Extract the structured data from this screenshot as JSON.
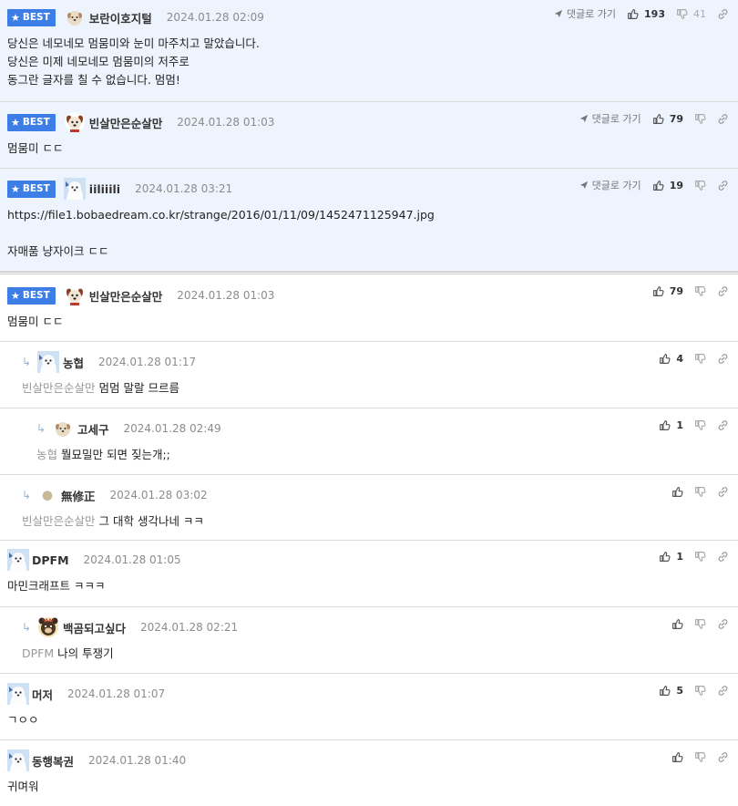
{
  "ui": {
    "reply_label": "댓글로 가기",
    "best_label": "BEST"
  },
  "comments": [
    {
      "best": true,
      "nick": "보란이호지털",
      "date": "2024.01.28 02:09",
      "up": "193",
      "down": "41",
      "lines": [
        "당신은 네모네모 멈뭄미와 눈미 마주치고 말았습니다.",
        "당신은 미제 네모네모 멈뭄미의 저주로",
        "동그란 글자를 칠 수 없습니다. 멈멈!"
      ]
    },
    {
      "best": true,
      "nick": "빈살만은순살만",
      "date": "2024.01.28 01:03",
      "up": "79",
      "lines": [
        "멈뭄미 ㄷㄷ"
      ]
    },
    {
      "best": true,
      "nick": "iiliiili",
      "date": "2024.01.28 03:21",
      "up": "19",
      "line1": "https://file1.bobaedream.co.kr/strange/2016/01/11/09/1452471125947.jpg",
      "line2": "자매품 냥자이크 ㄷㄷ"
    },
    {
      "best": true,
      "nick": "빈살만은순살만",
      "date": "2024.01.28 01:03",
      "up": "79",
      "lines": [
        "멈뭄미 ㄷㄷ"
      ]
    },
    {
      "nick": "농협",
      "date": "2024.01.28 01:17",
      "up": "4",
      "mention": "빈살만은순살만",
      "text": "멈멈 말랄 므르름"
    },
    {
      "nick": "고세구",
      "date": "2024.01.28 02:49",
      "up": "1",
      "mention": "농협",
      "text": "뭘묘밀만 되면 짖는개;;"
    },
    {
      "nick": "無修正",
      "date": "2024.01.28 03:02",
      "mention": "빈살만은순살만",
      "text": "그 대학 생각나네 ㅋㅋ"
    },
    {
      "nick": "DPFM",
      "date": "2024.01.28 01:05",
      "up": "1",
      "text": "마민크래프트 ㅋㅋㅋ"
    },
    {
      "nick": "백곰되고싶다",
      "date": "2024.01.28 02:21",
      "mention": "DPFM",
      "text": "나의 투쟁기"
    },
    {
      "nick": "머저",
      "date": "2024.01.28 01:07",
      "up": "5",
      "text": "ㄱㅇㅇ"
    },
    {
      "nick": "동행복권",
      "date": "2024.01.28 01:40",
      "text": "귀며워"
    }
  ],
  "colors": {
    "best_badge": "#3d7ee6",
    "best_bg": "#eef4fd"
  }
}
